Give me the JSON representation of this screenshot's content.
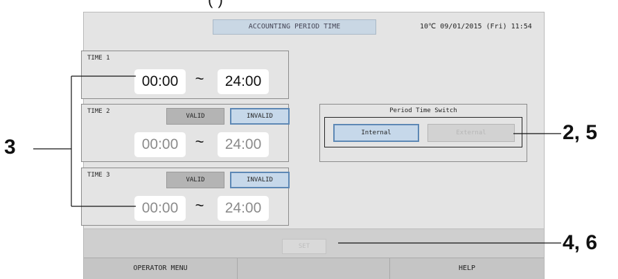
{
  "top_fragment": "(                                    )    ",
  "header": {
    "title": "ACCOUNTING PERIOD TIME",
    "status": "10℃  09/01/2015 (Fri) 11:54"
  },
  "time1": {
    "label": "TIME 1",
    "start": "00:00",
    "separator": "~",
    "end": "24:00"
  },
  "time2": {
    "label": "TIME 2",
    "valid_label": "VALID",
    "invalid_label": "INVALID",
    "start": "00:00",
    "separator": "~",
    "end": "24:00"
  },
  "time3": {
    "label": "TIME 3",
    "valid_label": "VALID",
    "invalid_label": "INVALID",
    "start": "00:00",
    "separator": "~",
    "end": "24:00"
  },
  "period_switch": {
    "title": "Period Time Switch",
    "internal_label": "Internal",
    "external_label": "External"
  },
  "actions": {
    "set_label": "SET"
  },
  "bottom_nav": {
    "operator_menu_label": "OPERATOR MENU",
    "middle_label": "",
    "help_label": "HELP"
  },
  "callouts": {
    "three": "3",
    "two_five": "2, 5",
    "four_six": "4, 6"
  },
  "colors": {
    "screen_bg": "#e4e4e4",
    "selected_fill": "#c6d8ea",
    "selected_border": "#5c87b4",
    "header_fill": "#c9d7e4"
  }
}
